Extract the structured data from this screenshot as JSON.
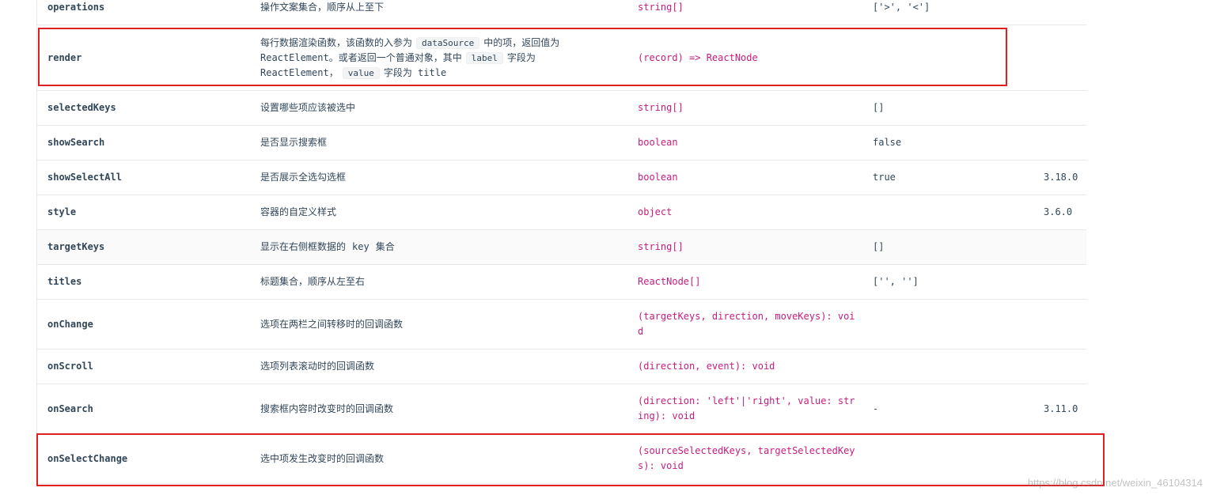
{
  "rows": [
    {
      "name": "operations",
      "desc": "操作文案集合，顺序从上至下",
      "type": "string[]",
      "default": "['>', '<']",
      "version": ""
    },
    {
      "name": "render",
      "desc_parts": {
        "l1a": "每行数据渲染函数，该函数的入参为",
        "c1": "dataSource",
        "l1b": "中的项，返回值为",
        "l2a": "ReactElement。或者返回一个普通对象，其中",
        "c2": "label",
        "l2b": "字段为",
        "l3a": "ReactElement，",
        "c3": "value",
        "l3b": "字段为 title"
      },
      "type": "(record) => ReactNode",
      "default": "",
      "version": ""
    },
    {
      "name": "selectedKeys",
      "desc": "设置哪些项应该被选中",
      "type": "string[]",
      "default": "[]",
      "version": ""
    },
    {
      "name": "showSearch",
      "desc": "是否显示搜索框",
      "type": "boolean",
      "default": "false",
      "version": ""
    },
    {
      "name": "showSelectAll",
      "desc": "是否展示全选勾选框",
      "type": "boolean",
      "default": "true",
      "version": "3.18.0"
    },
    {
      "name": "style",
      "desc": "容器的自定义样式",
      "type": "object",
      "default": "",
      "version": "3.6.0"
    },
    {
      "name": "targetKeys",
      "desc_a": "显示在右侧框数据的",
      "desc_code": "key",
      "desc_b": "集合",
      "type": "string[]",
      "default": "[]",
      "version": ""
    },
    {
      "name": "titles",
      "desc": "标题集合，顺序从左至右",
      "type": "ReactNode[]",
      "default": "['', '']",
      "version": ""
    },
    {
      "name": "onChange",
      "desc": "选项在两栏之间转移时的回调函数",
      "type": "(targetKeys, direction, moveKeys): void",
      "default": "",
      "version": ""
    },
    {
      "name": "onScroll",
      "desc": "选项列表滚动时的回调函数",
      "type": "(direction, event): void",
      "default": "",
      "version": ""
    },
    {
      "name": "onSearch",
      "desc": "搜索框内容时改变时的回调函数",
      "type": "(direction: 'left'|'right', value: string): void",
      "default": "-",
      "version": "3.11.0"
    },
    {
      "name": "onSelectChange",
      "desc": "选中项发生改变时的回调函数",
      "type": "(sourceSelectedKeys, targetSelectedKeys): void",
      "default": "",
      "version": ""
    }
  ],
  "watermark": "https://blog.csdn.net/weixin_46104314",
  "colors": {
    "type_text": "#c41d7f",
    "highlight_border": "#e02020",
    "stripe": "#fafafa"
  }
}
